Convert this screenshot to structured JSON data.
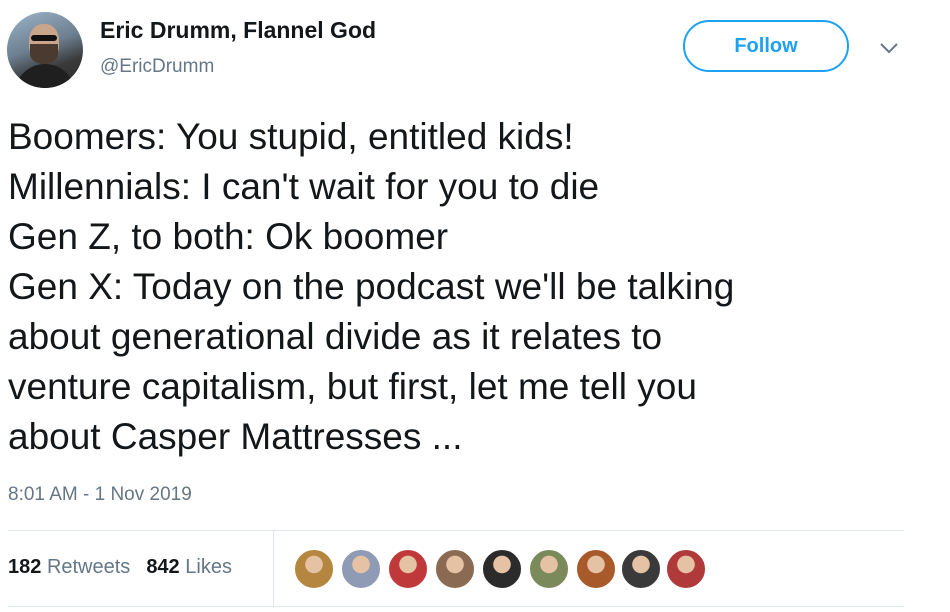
{
  "author": {
    "name": "Eric Drumm, Flannel God",
    "handle": "@EricDrumm"
  },
  "header": {
    "follow_label": "Follow"
  },
  "tweet": {
    "lines": [
      "Boomers: You stupid, entitled kids!",
      "Millennials: I can't wait for you to die",
      "Gen Z, to both: Ok boomer",
      "Gen X: Today on the podcast we'll be talking",
      "about generational divide as it relates to",
      "venture capitalism, but first, let me tell you",
      "about Casper Mattresses ..."
    ],
    "timestamp": "8:01 AM - 1 Nov 2019"
  },
  "stats": {
    "retweets_count": "182",
    "retweets_label": "Retweets",
    "likes_count": "842",
    "likes_label": "Likes"
  },
  "liker_avatars": [
    {
      "color": "#b5863f"
    },
    {
      "color": "#8f9bb5"
    },
    {
      "color": "#c0393a"
    },
    {
      "color": "#8a6a52"
    },
    {
      "color": "#2b2b2b"
    },
    {
      "color": "#7a8a5a"
    },
    {
      "color": "#a85a2a"
    },
    {
      "color": "#3a3a3a"
    },
    {
      "color": "#b03a3a"
    }
  ],
  "colors": {
    "accent": "#1da1f2",
    "secondary_text": "#657786",
    "primary_text": "#14171a"
  }
}
